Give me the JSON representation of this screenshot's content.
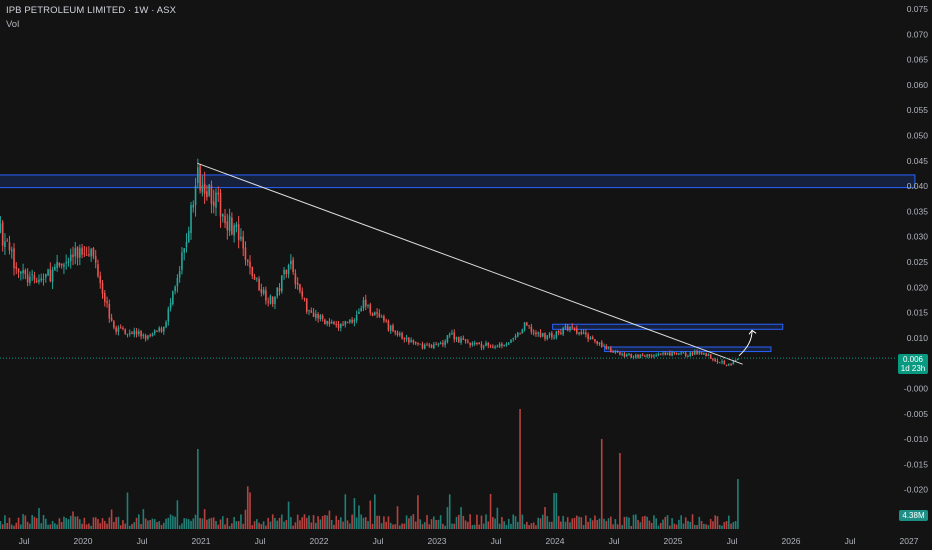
{
  "header": {
    "title": "IPB PETROLEUM LIMITED · 1W · ASX",
    "volume_label": "Vol"
  },
  "price_badge": {
    "price": "0.006",
    "countdown": "1d 23h"
  },
  "volume_badge": {
    "value": "4.38M"
  },
  "colors": {
    "background": "#131313",
    "up": "#26a69a",
    "down": "#ef5350",
    "zone": "#2962ff",
    "trendline": "#ffffff",
    "price_line": "#089981",
    "axis_text": "#b2b5be"
  },
  "chart_data": {
    "type": "candlestick",
    "y_axis_labels": [
      "0.075",
      "0.070",
      "0.065",
      "0.060",
      "0.055",
      "0.050",
      "0.045",
      "0.040",
      "0.035",
      "0.030",
      "0.025",
      "0.020",
      "0.015",
      "0.010",
      "0.005",
      "-0.000",
      "-0.005",
      "-0.010",
      "-0.015",
      "-0.020"
    ],
    "x_axis_labels": [
      "Jul",
      "2020",
      "Jul",
      "2021",
      "Jul",
      "2022",
      "Jul",
      "2023",
      "Jul",
      "2024",
      "Jul",
      "2025",
      "Jul",
      "2026",
      "Jul",
      "2027"
    ],
    "x_axis_dates": [
      2019.5,
      2020,
      2020.5,
      2021,
      2021.5,
      2022,
      2022.5,
      2023,
      2023.5,
      2024,
      2024.5,
      2025,
      2025.5,
      2026,
      2026.5,
      2027
    ],
    "y_range": [
      -0.0225,
      0.0755
    ],
    "current_price": 0.006,
    "anchors": [
      [
        2019.05,
        0.04
      ],
      [
        2019.2,
        0.037
      ],
      [
        2019.35,
        0.028
      ],
      [
        2019.5,
        0.022
      ],
      [
        2019.6,
        0.021
      ],
      [
        2019.75,
        0.023
      ],
      [
        2019.9,
        0.026
      ],
      [
        2020.05,
        0.028
      ],
      [
        2020.12,
        0.024
      ],
      [
        2020.25,
        0.012
      ],
      [
        2020.45,
        0.011
      ],
      [
        2020.55,
        0.01
      ],
      [
        2020.68,
        0.012
      ],
      [
        2020.8,
        0.021
      ],
      [
        2020.88,
        0.03
      ],
      [
        2020.97,
        0.042
      ],
      [
        2021.03,
        0.041
      ],
      [
        2021.1,
        0.038
      ],
      [
        2021.2,
        0.034
      ],
      [
        2021.3,
        0.031
      ],
      [
        2021.4,
        0.024
      ],
      [
        2021.5,
        0.02
      ],
      [
        2021.6,
        0.017
      ],
      [
        2021.65,
        0.019
      ],
      [
        2021.75,
        0.026
      ],
      [
        2021.82,
        0.02
      ],
      [
        2021.9,
        0.016
      ],
      [
        2022.0,
        0.014
      ],
      [
        2022.15,
        0.012
      ],
      [
        2022.3,
        0.014
      ],
      [
        2022.38,
        0.017
      ],
      [
        2022.5,
        0.014
      ],
      [
        2022.6,
        0.012
      ],
      [
        2022.7,
        0.01
      ],
      [
        2022.85,
        0.0085
      ],
      [
        2023.0,
        0.0085
      ],
      [
        2023.05,
        0.009
      ],
      [
        2023.1,
        0.011
      ],
      [
        2023.2,
        0.0095
      ],
      [
        2023.35,
        0.0085
      ],
      [
        2023.5,
        0.0085
      ],
      [
        2023.65,
        0.0095
      ],
      [
        2023.75,
        0.0125
      ],
      [
        2023.85,
        0.0105
      ],
      [
        2024.0,
        0.0105
      ],
      [
        2024.1,
        0.012
      ],
      [
        2024.2,
        0.011
      ],
      [
        2024.35,
        0.0095
      ],
      [
        2024.45,
        0.0075
      ],
      [
        2024.6,
        0.0065
      ],
      [
        2024.8,
        0.0065
      ],
      [
        2025.0,
        0.0068
      ],
      [
        2025.15,
        0.0068
      ],
      [
        2025.25,
        0.0072
      ],
      [
        2025.35,
        0.0058
      ],
      [
        2025.45,
        0.005
      ],
      [
        2025.52,
        0.0052
      ],
      [
        2025.56,
        0.006
      ]
    ],
    "volume_spikes": [
      [
        2020.98,
        4.0
      ],
      [
        2023.7,
        6.0
      ],
      [
        2024.0,
        1.8
      ],
      [
        2024.4,
        4.5
      ],
      [
        2024.55,
        3.8
      ],
      [
        2025.55,
        2.5
      ]
    ],
    "zones": [
      {
        "name": "upper-resistance",
        "x_start": 2019.0,
        "x_end": 2027.05,
        "y_low": 0.0397,
        "y_high": 0.0422
      },
      {
        "name": "mid-resistance",
        "x_start": 2023.98,
        "x_end": 2025.93,
        "y_low": 0.0117,
        "y_high": 0.0127
      },
      {
        "name": "lower-zone",
        "x_start": 2024.42,
        "x_end": 2025.83,
        "y_low": 0.0073,
        "y_high": 0.0082
      }
    ],
    "trendline": {
      "start": [
        2020.97,
        0.0445
      ],
      "end": [
        2025.59,
        0.0048
      ]
    },
    "projection": {
      "points": [
        [
          2025.56,
          0.0065
        ],
        [
          2025.62,
          0.0088
        ],
        [
          2025.67,
          0.0115
        ]
      ]
    },
    "grid": false
  }
}
